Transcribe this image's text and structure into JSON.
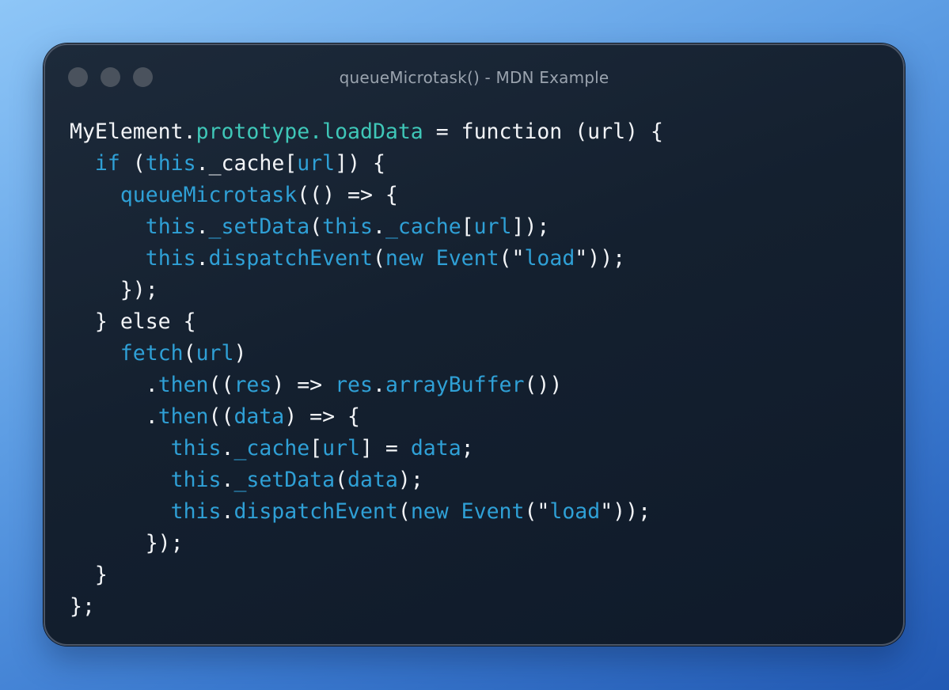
{
  "window": {
    "title": "queueMicrotask() - MDN Example",
    "controls": [
      "close-dot",
      "minimize-dot",
      "maximize-dot"
    ]
  },
  "colors": {
    "background_gradient": [
      "#8ec6f7",
      "#2259b3"
    ],
    "window_bg": "#14202f",
    "plain_text": "#f2f4f7",
    "property": "#3fc7b8",
    "keyword_identifier": "#2fa0d6",
    "title_text": "#9aa3ae",
    "window_dot": "#4a525d"
  },
  "code": {
    "language": "javascript",
    "lines": [
      [
        {
          "t": "MyElement",
          "c": "plain"
        },
        {
          "t": ".",
          "c": "plain"
        },
        {
          "t": "prototype",
          "c": "prop"
        },
        {
          "t": ".",
          "c": "prop"
        },
        {
          "t": "loadData",
          "c": "prop"
        },
        {
          "t": " = function (url) {",
          "c": "plain"
        }
      ],
      [
        {
          "t": "  ",
          "c": "plain"
        },
        {
          "t": "if",
          "c": "kw"
        },
        {
          "t": " (",
          "c": "plain"
        },
        {
          "t": "this",
          "c": "id"
        },
        {
          "t": ".",
          "c": "plain"
        },
        {
          "t": "_cache",
          "c": "plain"
        },
        {
          "t": "[",
          "c": "plain"
        },
        {
          "t": "url",
          "c": "id"
        },
        {
          "t": "]) {",
          "c": "plain"
        }
      ],
      [
        {
          "t": "    ",
          "c": "plain"
        },
        {
          "t": "queueMicrotask",
          "c": "id"
        },
        {
          "t": "(() => {",
          "c": "plain"
        }
      ],
      [
        {
          "t": "      ",
          "c": "plain"
        },
        {
          "t": "this",
          "c": "id"
        },
        {
          "t": ".",
          "c": "plain"
        },
        {
          "t": "_setData",
          "c": "id"
        },
        {
          "t": "(",
          "c": "plain"
        },
        {
          "t": "this",
          "c": "id"
        },
        {
          "t": ".",
          "c": "plain"
        },
        {
          "t": "_cache",
          "c": "id"
        },
        {
          "t": "[",
          "c": "plain"
        },
        {
          "t": "url",
          "c": "id"
        },
        {
          "t": "]);",
          "c": "plain"
        }
      ],
      [
        {
          "t": "      ",
          "c": "plain"
        },
        {
          "t": "this",
          "c": "id"
        },
        {
          "t": ".",
          "c": "plain"
        },
        {
          "t": "dispatchEvent",
          "c": "id"
        },
        {
          "t": "(",
          "c": "plain"
        },
        {
          "t": "new",
          "c": "kw"
        },
        {
          "t": " ",
          "c": "plain"
        },
        {
          "t": "Event",
          "c": "id"
        },
        {
          "t": "(\"",
          "c": "plain"
        },
        {
          "t": "load",
          "c": "id"
        },
        {
          "t": "\"));",
          "c": "plain"
        }
      ],
      [
        {
          "t": "    });",
          "c": "plain"
        }
      ],
      [
        {
          "t": "  } else {",
          "c": "plain"
        }
      ],
      [
        {
          "t": "    ",
          "c": "plain"
        },
        {
          "t": "fetch",
          "c": "id"
        },
        {
          "t": "(",
          "c": "plain"
        },
        {
          "t": "url",
          "c": "id"
        },
        {
          "t": ")",
          "c": "plain"
        }
      ],
      [
        {
          "t": "      .",
          "c": "plain"
        },
        {
          "t": "then",
          "c": "id"
        },
        {
          "t": "((",
          "c": "plain"
        },
        {
          "t": "res",
          "c": "id"
        },
        {
          "t": ") => ",
          "c": "plain"
        },
        {
          "t": "res",
          "c": "id"
        },
        {
          "t": ".",
          "c": "plain"
        },
        {
          "t": "arrayBuffer",
          "c": "id"
        },
        {
          "t": "())",
          "c": "plain"
        }
      ],
      [
        {
          "t": "      .",
          "c": "plain"
        },
        {
          "t": "then",
          "c": "id"
        },
        {
          "t": "((",
          "c": "plain"
        },
        {
          "t": "data",
          "c": "id"
        },
        {
          "t": ") => {",
          "c": "plain"
        }
      ],
      [
        {
          "t": "        ",
          "c": "plain"
        },
        {
          "t": "this",
          "c": "id"
        },
        {
          "t": ".",
          "c": "plain"
        },
        {
          "t": "_cache",
          "c": "id"
        },
        {
          "t": "[",
          "c": "plain"
        },
        {
          "t": "url",
          "c": "id"
        },
        {
          "t": "] = ",
          "c": "plain"
        },
        {
          "t": "data",
          "c": "id"
        },
        {
          "t": ";",
          "c": "plain"
        }
      ],
      [
        {
          "t": "        ",
          "c": "plain"
        },
        {
          "t": "this",
          "c": "id"
        },
        {
          "t": ".",
          "c": "plain"
        },
        {
          "t": "_setData",
          "c": "id"
        },
        {
          "t": "(",
          "c": "plain"
        },
        {
          "t": "data",
          "c": "id"
        },
        {
          "t": ");",
          "c": "plain"
        }
      ],
      [
        {
          "t": "        ",
          "c": "plain"
        },
        {
          "t": "this",
          "c": "id"
        },
        {
          "t": ".",
          "c": "plain"
        },
        {
          "t": "dispatchEvent",
          "c": "id"
        },
        {
          "t": "(",
          "c": "plain"
        },
        {
          "t": "new",
          "c": "kw"
        },
        {
          "t": " ",
          "c": "plain"
        },
        {
          "t": "Event",
          "c": "id"
        },
        {
          "t": "(\"",
          "c": "plain"
        },
        {
          "t": "load",
          "c": "id"
        },
        {
          "t": "\"));",
          "c": "plain"
        }
      ],
      [
        {
          "t": "      });",
          "c": "plain"
        }
      ],
      [
        {
          "t": "  }",
          "c": "plain"
        }
      ],
      [
        {
          "t": "};",
          "c": "plain"
        }
      ]
    ]
  }
}
